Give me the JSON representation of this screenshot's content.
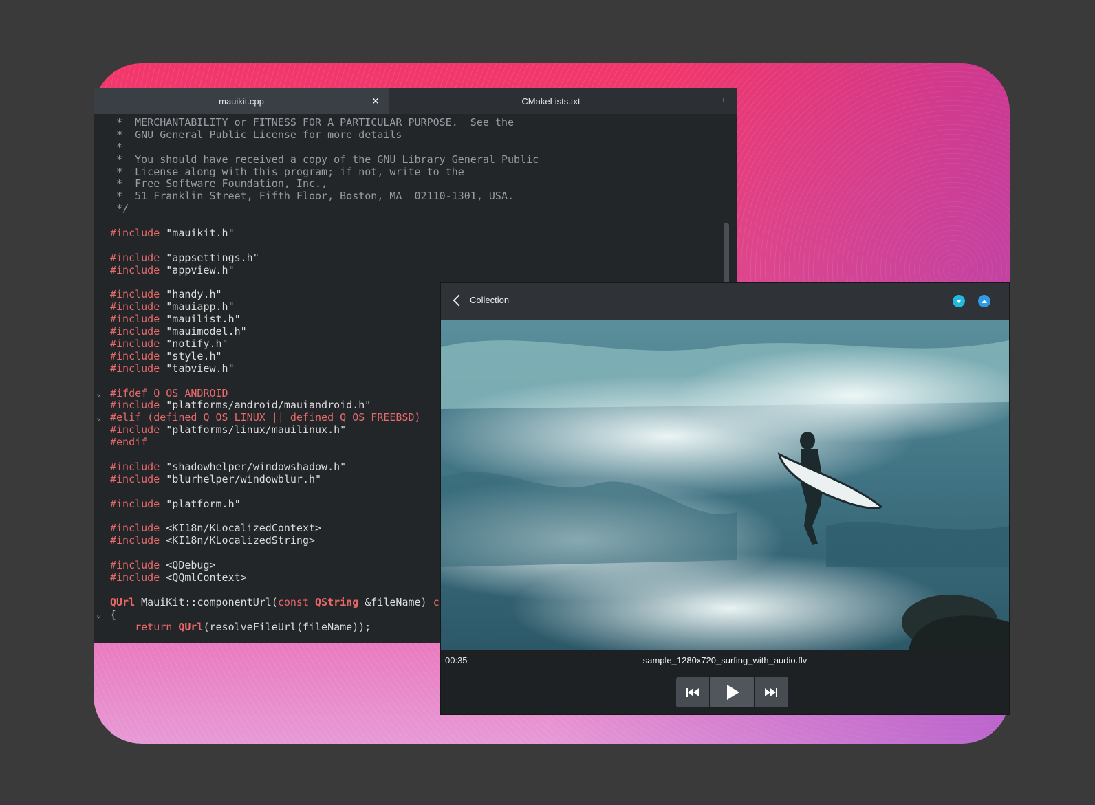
{
  "editor": {
    "tabs": [
      {
        "label": "mauikit.cpp",
        "active": true
      },
      {
        "label": "CMakeLists.txt",
        "active": false
      }
    ],
    "code_lines": [
      {
        "fold": "",
        "segments": [
          {
            "cls": "c-comment",
            "text": " *  MERCHANTABILITY or FITNESS FOR A PARTICULAR PURPOSE.  See the"
          }
        ]
      },
      {
        "fold": "",
        "segments": [
          {
            "cls": "c-comment",
            "text": " *  GNU General Public License for more details"
          }
        ]
      },
      {
        "fold": "",
        "segments": [
          {
            "cls": "c-comment",
            "text": " *"
          }
        ]
      },
      {
        "fold": "",
        "segments": [
          {
            "cls": "c-comment",
            "text": " *  You should have received a copy of the GNU Library General Public"
          }
        ]
      },
      {
        "fold": "",
        "segments": [
          {
            "cls": "c-comment",
            "text": " *  License along with this program; if not, write to the"
          }
        ]
      },
      {
        "fold": "",
        "segments": [
          {
            "cls": "c-comment",
            "text": " *  Free Software Foundation, Inc.,"
          }
        ]
      },
      {
        "fold": "",
        "segments": [
          {
            "cls": "c-comment",
            "text": " *  51 Franklin Street, Fifth Floor, Boston, MA  02110-1301, USA."
          }
        ]
      },
      {
        "fold": "",
        "segments": [
          {
            "cls": "c-comment",
            "text": " */"
          }
        ]
      },
      {
        "fold": "",
        "segments": []
      },
      {
        "fold": "",
        "segments": [
          {
            "cls": "c-pre",
            "text": "#include "
          },
          {
            "cls": "c-str",
            "text": "\"mauikit.h\""
          }
        ]
      },
      {
        "fold": "",
        "segments": []
      },
      {
        "fold": "",
        "segments": [
          {
            "cls": "c-pre",
            "text": "#include "
          },
          {
            "cls": "c-str",
            "text": "\"appsettings.h\""
          }
        ]
      },
      {
        "fold": "",
        "segments": [
          {
            "cls": "c-pre",
            "text": "#include "
          },
          {
            "cls": "c-str",
            "text": "\"appview.h\""
          }
        ]
      },
      {
        "fold": "",
        "segments": []
      },
      {
        "fold": "",
        "segments": [
          {
            "cls": "c-pre",
            "text": "#include "
          },
          {
            "cls": "c-str",
            "text": "\"handy.h\""
          }
        ]
      },
      {
        "fold": "",
        "segments": [
          {
            "cls": "c-pre",
            "text": "#include "
          },
          {
            "cls": "c-str",
            "text": "\"mauiapp.h\""
          }
        ]
      },
      {
        "fold": "",
        "segments": [
          {
            "cls": "c-pre",
            "text": "#include "
          },
          {
            "cls": "c-str",
            "text": "\"mauilist.h\""
          }
        ]
      },
      {
        "fold": "",
        "segments": [
          {
            "cls": "c-pre",
            "text": "#include "
          },
          {
            "cls": "c-str",
            "text": "\"mauimodel.h\""
          }
        ]
      },
      {
        "fold": "",
        "segments": [
          {
            "cls": "c-pre",
            "text": "#include "
          },
          {
            "cls": "c-str",
            "text": "\"notify.h\""
          }
        ]
      },
      {
        "fold": "",
        "segments": [
          {
            "cls": "c-pre",
            "text": "#include "
          },
          {
            "cls": "c-str",
            "text": "\"style.h\""
          }
        ]
      },
      {
        "fold": "",
        "segments": [
          {
            "cls": "c-pre",
            "text": "#include "
          },
          {
            "cls": "c-str",
            "text": "\"tabview.h\""
          }
        ]
      },
      {
        "fold": "",
        "segments": []
      },
      {
        "fold": "⌄",
        "segments": [
          {
            "cls": "c-pre",
            "text": "#ifdef Q_OS_ANDROID"
          }
        ]
      },
      {
        "fold": "",
        "segments": [
          {
            "cls": "c-pre",
            "text": "#include "
          },
          {
            "cls": "c-str",
            "text": "\"platforms/android/mauiandroid.h\""
          }
        ]
      },
      {
        "fold": "⌄",
        "segments": [
          {
            "cls": "c-pre",
            "text": "#elif (defined Q_OS_LINUX || defined Q_OS_FREEBSD)"
          }
        ]
      },
      {
        "fold": "",
        "segments": [
          {
            "cls": "c-pre",
            "text": "#include "
          },
          {
            "cls": "c-str",
            "text": "\"platforms/linux/mauilinux.h\""
          }
        ]
      },
      {
        "fold": "",
        "segments": [
          {
            "cls": "c-pre",
            "text": "#endif"
          }
        ]
      },
      {
        "fold": "",
        "segments": []
      },
      {
        "fold": "",
        "segments": [
          {
            "cls": "c-pre",
            "text": "#include "
          },
          {
            "cls": "c-str",
            "text": "\"shadowhelper/windowshadow.h\""
          }
        ]
      },
      {
        "fold": "",
        "segments": [
          {
            "cls": "c-pre",
            "text": "#include "
          },
          {
            "cls": "c-str",
            "text": "\"blurhelper/windowblur.h\""
          }
        ]
      },
      {
        "fold": "",
        "segments": []
      },
      {
        "fold": "",
        "segments": [
          {
            "cls": "c-pre",
            "text": "#include "
          },
          {
            "cls": "c-str",
            "text": "\"platform.h\""
          }
        ]
      },
      {
        "fold": "",
        "segments": []
      },
      {
        "fold": "",
        "segments": [
          {
            "cls": "c-pre",
            "text": "#include "
          },
          {
            "cls": "c-str",
            "text": "<KI18n/KLocalizedContext>"
          }
        ]
      },
      {
        "fold": "",
        "segments": [
          {
            "cls": "c-pre",
            "text": "#include "
          },
          {
            "cls": "c-str",
            "text": "<KI18n/KLocalizedString>"
          }
        ]
      },
      {
        "fold": "",
        "segments": []
      },
      {
        "fold": "",
        "segments": [
          {
            "cls": "c-pre",
            "text": "#include "
          },
          {
            "cls": "c-str",
            "text": "<QDebug>"
          }
        ]
      },
      {
        "fold": "",
        "segments": [
          {
            "cls": "c-pre",
            "text": "#include "
          },
          {
            "cls": "c-str",
            "text": "<QQmlContext>"
          }
        ]
      },
      {
        "fold": "",
        "segments": []
      },
      {
        "fold": "",
        "segments": [
          {
            "cls": "c-type",
            "text": "QUrl"
          },
          {
            "cls": "c-str",
            "text": " MauiKit::componentUrl("
          },
          {
            "cls": "c-kw",
            "text": "const"
          },
          {
            "cls": "c-str",
            "text": " "
          },
          {
            "cls": "c-type",
            "text": "QString"
          },
          {
            "cls": "c-str",
            "text": " &fileName) "
          },
          {
            "cls": "c-kw",
            "text": "co"
          }
        ]
      },
      {
        "fold": "⌄",
        "segments": [
          {
            "cls": "c-str",
            "text": "{"
          }
        ]
      },
      {
        "fold": "",
        "segments": [
          {
            "cls": "c-str",
            "text": "    "
          },
          {
            "cls": "c-kw",
            "text": "return"
          },
          {
            "cls": "c-str",
            "text": " "
          },
          {
            "cls": "c-type",
            "text": "QUrl"
          },
          {
            "cls": "c-str",
            "text": "(resolveFileUrl(fileName));"
          }
        ]
      }
    ]
  },
  "player": {
    "title": "Collection",
    "time": "00:35",
    "filename": "sample_1280x720_surfing_with_audio.flv"
  },
  "icons": {
    "back": "chevron-left-icon",
    "tab_close": "close-icon",
    "tab_add": "plus-icon",
    "prev": "skip-previous-icon",
    "play": "play-icon",
    "next": "skip-next-icon"
  },
  "colors": {
    "accent_cyan": "#22b8e0",
    "accent_blue": "#2f9ae8",
    "code_keyword": "#ec6767",
    "editor_bg": "#232629"
  }
}
